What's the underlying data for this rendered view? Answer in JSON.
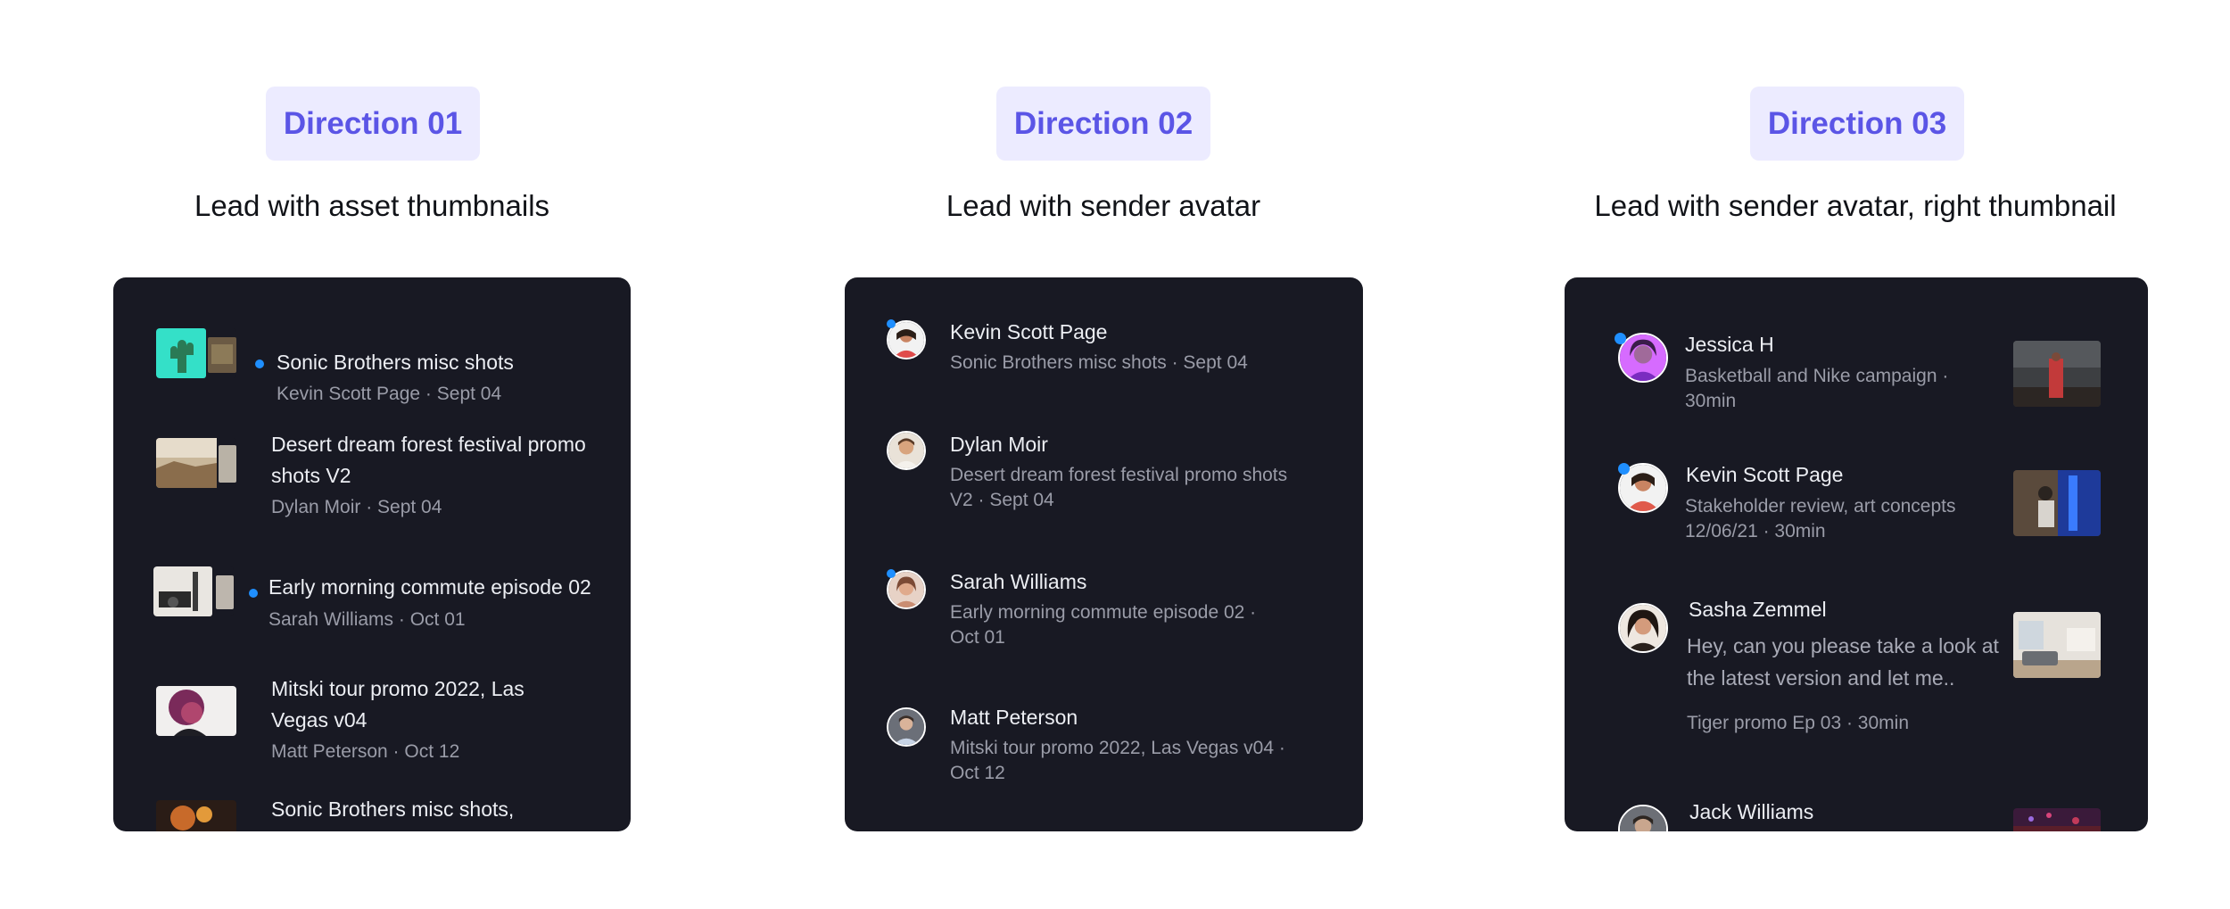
{
  "directions": [
    {
      "badge": "Direction 01",
      "subtitle": "Lead with asset thumbnails",
      "items": [
        {
          "title": "Sonic Brothers misc shots",
          "meta": "Kevin Scott Page · Sept 04",
          "unread": true
        },
        {
          "title": "Desert dream forest festival promo shots V2",
          "meta": "Dylan Moir · Sept 04",
          "unread": false
        },
        {
          "title": "Early morning commute episode 02",
          "meta": "Sarah Williams · Oct 01",
          "unread": true
        },
        {
          "title": "Mitski tour promo 2022, Las Vegas v04",
          "meta": "Matt Peterson · Oct 12",
          "unread": false
        },
        {
          "title": "Sonic Brothers misc shots,",
          "meta": "",
          "unread": false
        }
      ]
    },
    {
      "badge": "Direction 02",
      "subtitle": "Lead with sender avatar",
      "items": [
        {
          "sender": "Kevin Scott Page",
          "detail": "Sonic Brothers misc shots · Sept 04",
          "unread": true
        },
        {
          "sender": "Dylan Moir",
          "detail": "Desert dream forest festival promo shots V2 · Sept 04",
          "unread": false
        },
        {
          "sender": "Sarah Williams",
          "detail": "Early morning commute episode 02 · Oct 01",
          "unread": true
        },
        {
          "sender": "Matt Peterson",
          "detail": "Mitski tour promo 2022, Las Vegas v04 · Oct 12",
          "unread": false
        }
      ]
    },
    {
      "badge": "Direction 03",
      "subtitle": "Lead with sender avatar, right thumbnail",
      "items": [
        {
          "sender": "Jessica H",
          "detail": "Basketball and Nike campaign · 30min",
          "unread": true
        },
        {
          "sender": "Kevin Scott Page",
          "detail": "Stakeholder review, art concepts 12/06/21 · 30min",
          "unread": true
        },
        {
          "sender": "Sasha Zemmel",
          "detail": "Hey, can you please take a look at the latest version and let me..",
          "extra": "Tiger promo Ep 03 · 30min",
          "unread": false
        },
        {
          "sender": "Jack Williams",
          "detail": "",
          "unread": false
        }
      ]
    }
  ],
  "colors": {
    "badge_bg": "#ecebff",
    "badge_text": "#5b55e6",
    "panel_bg": "#181923",
    "unread_dot": "#1f8fff"
  }
}
